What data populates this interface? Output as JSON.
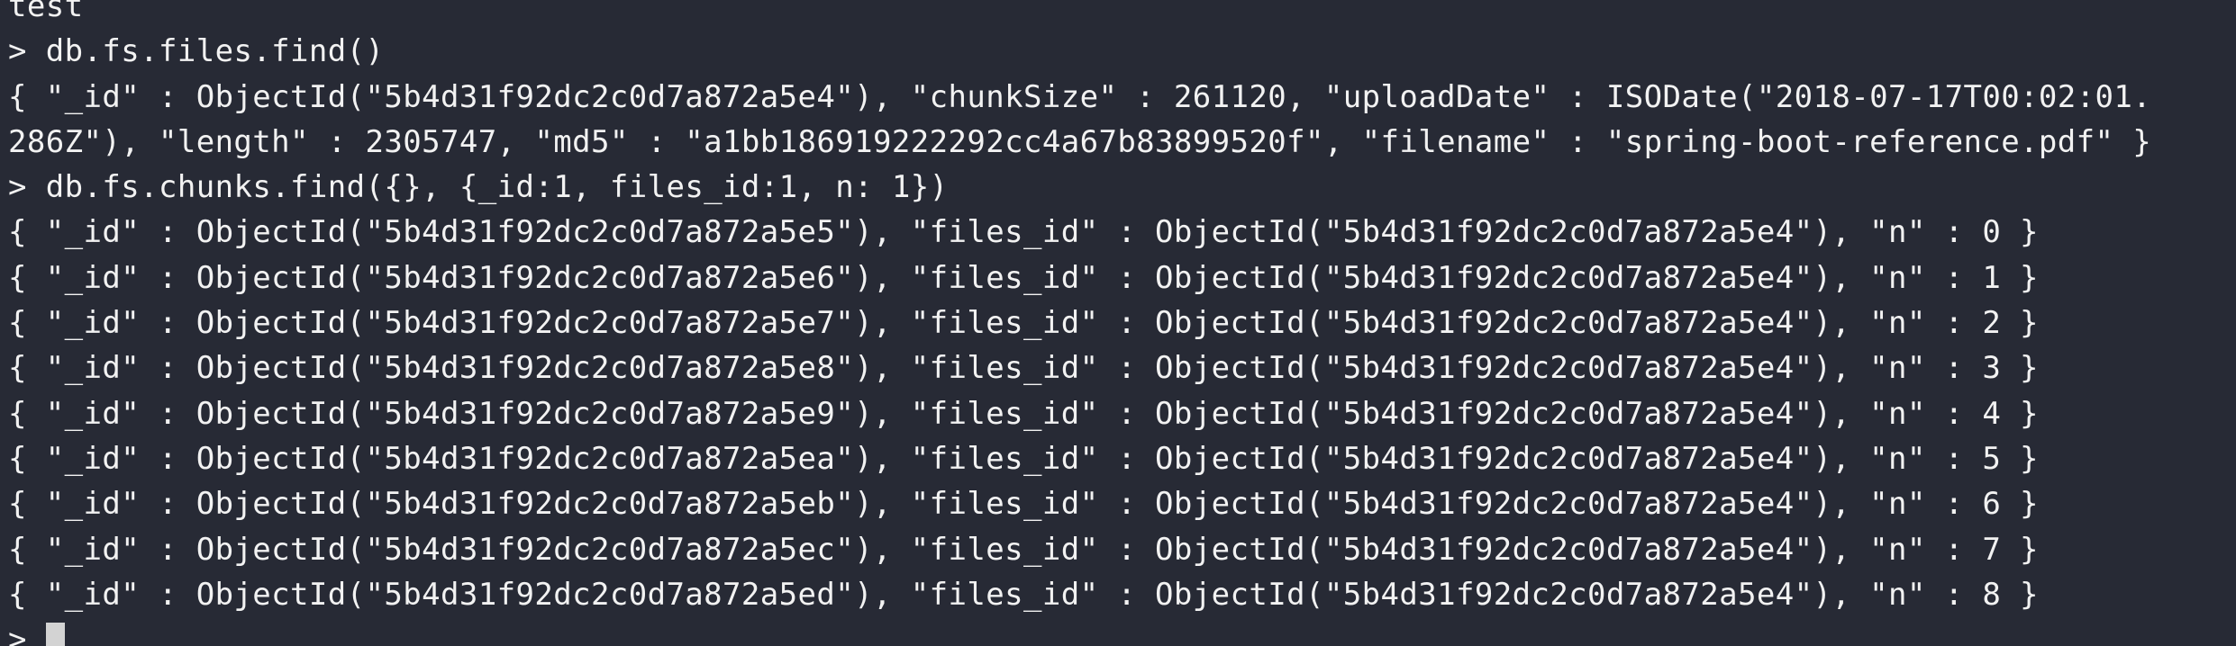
{
  "terminal": {
    "lines": [
      {
        "type": "output",
        "text": "test"
      },
      {
        "type": "command",
        "prompt": ">",
        "text": "db.fs.files.find()"
      },
      {
        "type": "output",
        "text": "{ \"_id\" : ObjectId(\"5b4d31f92dc2c0d7a872a5e4\"), \"chunkSize\" : 261120, \"uploadDate\" : ISODate(\"2018-07-17T00:02:01."
      },
      {
        "type": "output",
        "text": "286Z\"), \"length\" : 2305747, \"md5\" : \"a1bb186919222292cc4a67b83899520f\", \"filename\" : \"spring-boot-reference.pdf\" }"
      },
      {
        "type": "command",
        "prompt": ">",
        "text": "db.fs.chunks.find({}, {_id:1, files_id:1, n: 1})"
      },
      {
        "type": "output",
        "text": "{ \"_id\" : ObjectId(\"5b4d31f92dc2c0d7a872a5e5\"), \"files_id\" : ObjectId(\"5b4d31f92dc2c0d7a872a5e4\"), \"n\" : 0 }"
      },
      {
        "type": "output",
        "text": "{ \"_id\" : ObjectId(\"5b4d31f92dc2c0d7a872a5e6\"), \"files_id\" : ObjectId(\"5b4d31f92dc2c0d7a872a5e4\"), \"n\" : 1 }"
      },
      {
        "type": "output",
        "text": "{ \"_id\" : ObjectId(\"5b4d31f92dc2c0d7a872a5e7\"), \"files_id\" : ObjectId(\"5b4d31f92dc2c0d7a872a5e4\"), \"n\" : 2 }"
      },
      {
        "type": "output",
        "text": "{ \"_id\" : ObjectId(\"5b4d31f92dc2c0d7a872a5e8\"), \"files_id\" : ObjectId(\"5b4d31f92dc2c0d7a872a5e4\"), \"n\" : 3 }"
      },
      {
        "type": "output",
        "text": "{ \"_id\" : ObjectId(\"5b4d31f92dc2c0d7a872a5e9\"), \"files_id\" : ObjectId(\"5b4d31f92dc2c0d7a872a5e4\"), \"n\" : 4 }"
      },
      {
        "type": "output",
        "text": "{ \"_id\" : ObjectId(\"5b4d31f92dc2c0d7a872a5ea\"), \"files_id\" : ObjectId(\"5b4d31f92dc2c0d7a872a5e4\"), \"n\" : 5 }"
      },
      {
        "type": "output",
        "text": "{ \"_id\" : ObjectId(\"5b4d31f92dc2c0d7a872a5eb\"), \"files_id\" : ObjectId(\"5b4d31f92dc2c0d7a872a5e4\"), \"n\" : 6 }"
      },
      {
        "type": "output",
        "text": "{ \"_id\" : ObjectId(\"5b4d31f92dc2c0d7a872a5ec\"), \"files_id\" : ObjectId(\"5b4d31f92dc2c0d7a872a5e4\"), \"n\" : 7 }"
      },
      {
        "type": "output",
        "text": "{ \"_id\" : ObjectId(\"5b4d31f92dc2c0d7a872a5ed\"), \"files_id\" : ObjectId(\"5b4d31f92dc2c0d7a872a5e4\"), \"n\" : 8 }"
      }
    ],
    "current_prompt": {
      "prompt": ">",
      "input": ""
    }
  },
  "colors": {
    "background": "#272a35",
    "text": "#f2f2f2",
    "cursor": "#d3d3d3"
  }
}
